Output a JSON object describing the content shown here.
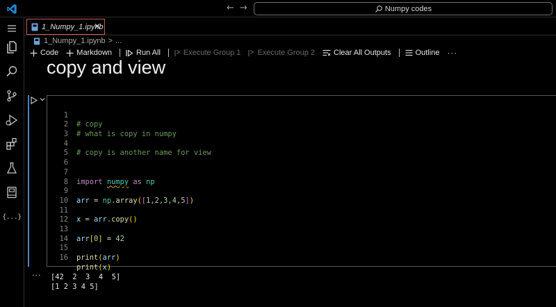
{
  "window": {
    "search_text": "Numpy codes",
    "nav_back": "←",
    "nav_forward": "→"
  },
  "tab": {
    "label": "1_Numpy_1.ipynb",
    "close": "✕"
  },
  "breadcrumb": {
    "file": "1_Numpy_1.ipynb",
    "separator": ">",
    "more": "..."
  },
  "toolbar": {
    "code": "Code",
    "markdown": "Markdown",
    "run_all": "Run All",
    "execute_group_1": "Execute Group 1",
    "execute_group_2": "Execute Group 2",
    "clear_outputs": "Clear All Outputs",
    "outline": "Outline",
    "more": "···"
  },
  "markdown_cell": {
    "heading": "copy and view"
  },
  "code_cell": {
    "line_numbers": [
      "1",
      "2",
      "3",
      "4",
      "5",
      "6",
      "7",
      "8",
      "9",
      "10",
      "11",
      "12",
      "13",
      "14",
      "15",
      "16"
    ],
    "l1": "# copy",
    "l2": "# what is copy in numpy",
    "l4": "# copy is another name for view",
    "l7_kw1": "import",
    "l7_mod": "numpy",
    "l7_kw2": "as",
    "l7_alias": "np",
    "l9_var": "arr",
    "l9_eq": " = ",
    "l9_mod": "np",
    "l9_dot": ".",
    "l9_fn": "array",
    "l9_open1": "(",
    "l9_open2": "[",
    "l9_nums": "1,2,3,4,5",
    "l9_close2": "]",
    "l9_close1": ")",
    "l11_var": "x",
    "l11_eq": " = ",
    "l11_obj": "arr",
    "l11_dot": ".",
    "l11_fn": "copy",
    "l11_paren": "()",
    "l13_var": "arr",
    "l13_open": "[",
    "l13_idx": "0",
    "l13_close": "]",
    "l13_eq": " = ",
    "l13_val": "42",
    "l15_fn": "print",
    "l15_open": "(",
    "l15_arg": "arr",
    "l15_close": ")",
    "l16_fn": "print",
    "l16_open": "(",
    "l16_arg": "x",
    "l16_close": ")"
  },
  "output": {
    "more": "···",
    "lines": [
      "[42  2  3  4  5]",
      "[1 2 3 4 5]"
    ]
  },
  "activity_bar": {
    "extensions_json": "{...}"
  },
  "colors": {
    "accent_cell_bar": "#4f83c3",
    "tab_border": "#c85a5a",
    "vscode_logo": "#0065a9"
  }
}
